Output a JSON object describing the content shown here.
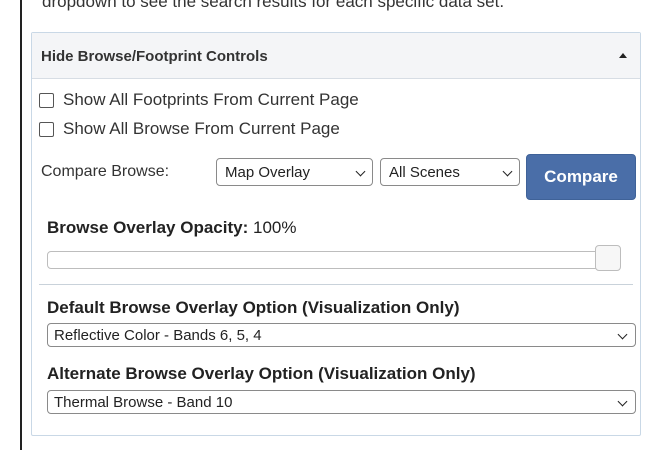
{
  "header_text": "dropdown to see the search results for each specific data set.",
  "panel": {
    "title": "Hide Browse/Footprint Controls",
    "checkboxes": [
      {
        "label": "Show All Footprints From Current Page",
        "checked": false
      },
      {
        "label": "Show All Browse From Current Page",
        "checked": false
      }
    ],
    "compare": {
      "label": "Compare Browse:",
      "mode_value": "Map Overlay",
      "scenes_value": "All Scenes",
      "button_label": "Compare"
    },
    "opacity": {
      "label": "Browse Overlay Opacity:",
      "value_text": "100%",
      "value_percent": 100
    },
    "default_overlay": {
      "label": "Default Browse Overlay Option (Visualization Only)",
      "value": "Reflective Color - Bands 6, 5, 4"
    },
    "alternate_overlay": {
      "label": "Alternate Browse Overlay Option (Visualization Only)",
      "value": "Thermal Browse - Band 10"
    }
  },
  "colors": {
    "button_bg": "#4a6ea8",
    "panel_border": "#c9d8e6",
    "header_bg": "#f4f5f7"
  }
}
